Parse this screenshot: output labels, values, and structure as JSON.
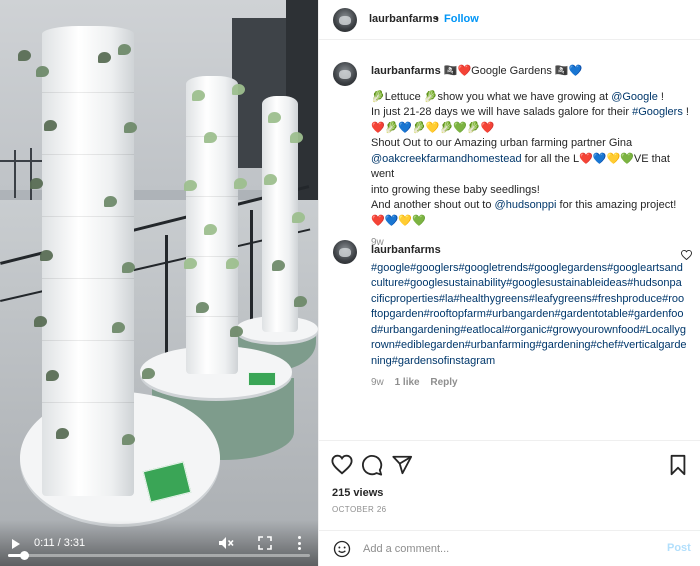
{
  "video": {
    "time": "0:11 / 3:31",
    "progress": 0.052,
    "icons": [
      "play-icon",
      "mute-icon",
      "fullscreen-icon",
      "more-vertical-icon"
    ]
  },
  "header": {
    "username": "laurbanfarms",
    "separator": "•",
    "follow_label": "Follow"
  },
  "caption": {
    "username": "laurbanfarms",
    "title": "🏴‍☠️❤️Google Gardens 🏴‍☠️💙",
    "line1_a": "🥬Lettuce 🥬show you what we have growing at ",
    "line1_link": "@Google",
    "line1_b": " !",
    "line2_a": "In just 21-28 days we will have salads galore for their ",
    "line2_link": "#Googlers",
    "line2_b": " !",
    "emoji_row": "❤️🥬💙🥬💛🥬💚🥬❤️",
    "line3": "Shout Out to our Amazing urban farming partner Gina",
    "line4_link": "@oakcreekfarmandhomestead",
    "line4_b": " for all the L❤️💙💛💚VE that went",
    "line5": "into growing these baby seedlings!",
    "line6_a": "And another shout out to ",
    "line6_link": "@hudsonppi",
    "line6_b": " for this amazing project!",
    "hearts": "❤️💙💛💚",
    "age": "9w"
  },
  "comment": {
    "username": "laurbanfarms",
    "tags": "#google#googlers#googletrends#googlegardens#googleartsandculture#googlesustainability#googlesustainableideas#hudsonpacificproperties#la#healthygreens#leafygreens#freshproduce#rooftopgarden#rooftopfarm#urbangarden#gardentotable#gardenfood#urbangardening#eatlocal#organic#growyourownfood#Locallygrown#ediblegarden#urbanfarming#gardening#chef#verticalgardening#gardensofinstagram",
    "age": "9w",
    "likes": "1 like",
    "reply_label": "Reply"
  },
  "stats": {
    "views": "215 views",
    "date": "OCTOBER 26"
  },
  "add_comment": {
    "placeholder": "Add a comment...",
    "post_label": "Post"
  },
  "colors": {
    "link": "#00376b",
    "follow": "#0095f6",
    "post_disabled": "#b2dffc",
    "muted": "#8e8e8e"
  }
}
